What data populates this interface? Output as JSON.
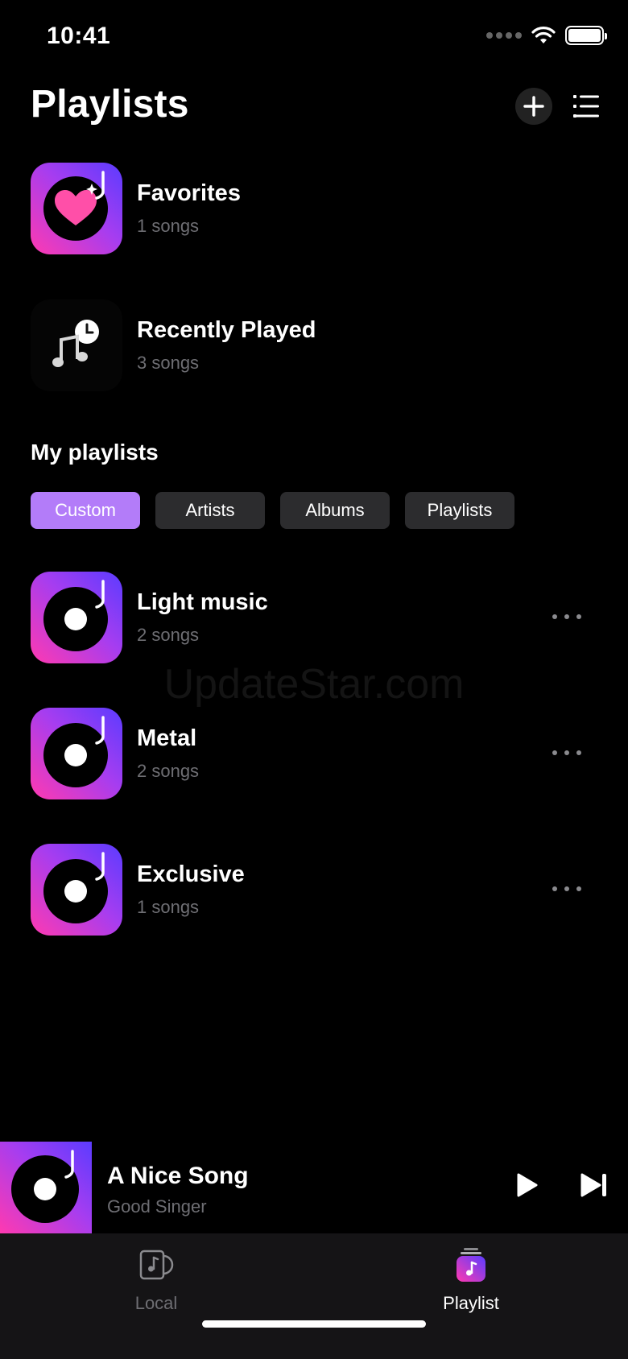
{
  "status_bar": {
    "time": "10:41"
  },
  "header": {
    "title": "Playlists"
  },
  "pinned": [
    {
      "title": "Favorites",
      "subtitle": "1 songs",
      "icon": "heart-icon"
    },
    {
      "title": "Recently Played",
      "subtitle": "3 songs",
      "icon": "clock-music-icon"
    }
  ],
  "section": {
    "title": "My playlists"
  },
  "filters": [
    {
      "label": "Custom",
      "active": true
    },
    {
      "label": "Artists",
      "active": false
    },
    {
      "label": "Albums",
      "active": false
    },
    {
      "label": "Playlists",
      "active": false
    }
  ],
  "playlists": [
    {
      "title": "Light music",
      "subtitle": "2 songs"
    },
    {
      "title": "Metal",
      "subtitle": "2 songs"
    },
    {
      "title": "Exclusive",
      "subtitle": "1 songs"
    }
  ],
  "watermark": "UpdateStar.com",
  "now_playing": {
    "title": "A Nice Song",
    "artist": "Good Singer"
  },
  "tabs": {
    "local": "Local",
    "playlist": "Playlist"
  },
  "colors": {
    "accent": "#b37cf9",
    "gradient_start": "#5b3cff",
    "gradient_end": "#ff3ab0",
    "background": "#000000"
  }
}
